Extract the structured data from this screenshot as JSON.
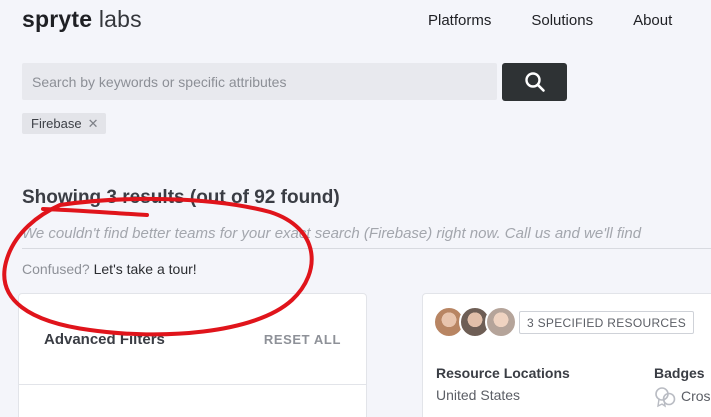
{
  "header": {
    "logo_bold": "spryte",
    "logo_light": "labs",
    "nav": [
      "Platforms",
      "Solutions",
      "About"
    ]
  },
  "search": {
    "placeholder": "Search by keywords or specific attributes",
    "value": "",
    "active_tag": "Firebase"
  },
  "results": {
    "title": "Showing 3 results (out of 92 found)",
    "note": "We couldn't find better teams for your exact search (Firebase) right now. Call us and we'll find",
    "tour_question": "Confused?",
    "tour_link": "Let's take a tour!"
  },
  "filters": {
    "title": "Advanced Filters",
    "reset_label": "RESET ALL"
  },
  "team_card": {
    "resources_badge": "3 SPECIFIED RESOURCES",
    "locations_label": "Resource Locations",
    "locations_value": "United States",
    "badges_label": "Badges",
    "badge_value": "Cros"
  },
  "icons": {
    "search": "search-icon",
    "tag_remove": "close-icon",
    "badge": "badge-icon"
  },
  "colors": {
    "background": "#f4f5fa",
    "search_button": "#2e3234",
    "annotation": "#e0141b"
  }
}
